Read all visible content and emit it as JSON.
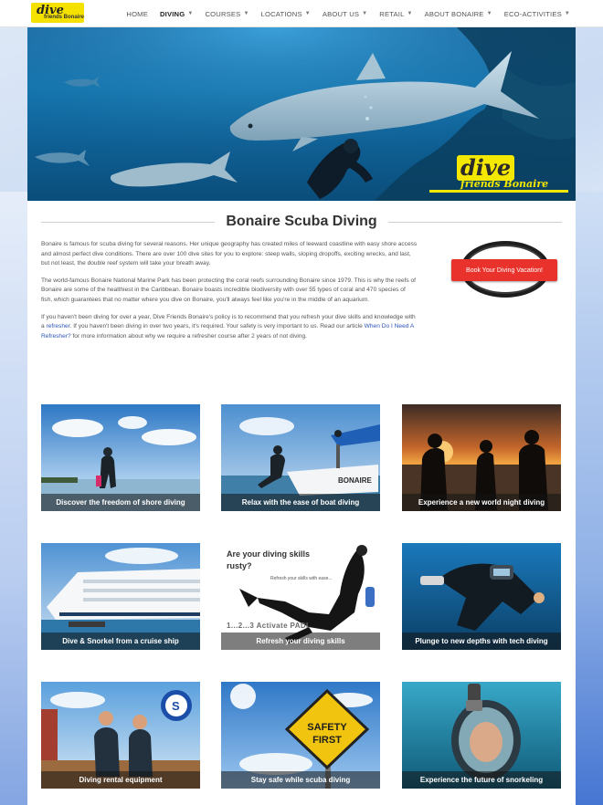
{
  "header": {
    "logo": {
      "word": "dive",
      "sub": "friends Bonaire"
    },
    "nav": [
      {
        "label": "HOME",
        "dropdown": false,
        "active": false
      },
      {
        "label": "DIVING",
        "dropdown": true,
        "active": true
      },
      {
        "label": "COURSES",
        "dropdown": true,
        "active": false
      },
      {
        "label": "LOCATIONS",
        "dropdown": true,
        "active": false
      },
      {
        "label": "ABOUT US",
        "dropdown": true,
        "active": false
      },
      {
        "label": "RETAIL",
        "dropdown": true,
        "active": false
      },
      {
        "label": "ABOUT BONAIRE",
        "dropdown": true,
        "active": false
      },
      {
        "label": "ECO-ACTIVITIES",
        "dropdown": true,
        "active": false
      }
    ]
  },
  "hero": {
    "logo_word": "dive",
    "logo_sub": "friends Bonaire"
  },
  "page": {
    "title": "Bonaire Scuba Diving",
    "para1": "Bonaire is famous for scuba diving for several reasons. Her unique geography has created miles of leeward coastline with easy shore access and almost perfect dive conditions. There are over 100 dive sites for you to explore: steep walls, sloping dropoffs, exciting wrecks, and last, but not least, the double reef system will take your breath away.",
    "para2": "The world-famous Bonaire National Marine Park has been protecting the coral reefs surrounding Bonaire since 1979. This is why the reefs of Bonaire are some of the healthiest in the Caribbean. Bonaire boasts incredible biodiversity with over 55 types of coral and 470 species of fish, which guarantees that no matter where you dive on Bonaire, you'll always feel like you're in the middle of an aquarium.",
    "para3_a": "If you haven't been diving for over a year, Dive Friends Bonaire's policy is to recommend that you refresh your dive skills and knowledge with a ",
    "para3_link1": "refresher",
    "para3_b": ". If you haven't been diving in over two years, it's required. Your safety is very important to us. Read our article ",
    "para3_link2": "When Do I Need A Refresher?",
    "para3_c": " for more information about why we require a refresher course after 2 years of not diving.",
    "book_button": "Book Your Diving Vacation!"
  },
  "tiles": [
    {
      "caption": "Discover the freedom of shore diving"
    },
    {
      "caption": "Relax with the ease of boat diving"
    },
    {
      "caption": "Experience a new world night diving"
    },
    {
      "caption": "Dive & Snorkel from a cruise ship"
    },
    {
      "caption": "Refresh your diving skills",
      "heading": "Are your diving skills rusty?",
      "sub": "Refresh your skills with ease...",
      "footer": "1...2...3 Activate PADI"
    },
    {
      "caption": "Plunge to new depths with tech diving"
    },
    {
      "caption": "Diving rental equipment"
    },
    {
      "caption": "Stay safe while scuba diving",
      "sign_line1": "SAFETY",
      "sign_line2": "FIRST"
    },
    {
      "caption": "Experience the future of snorkeling"
    }
  ]
}
